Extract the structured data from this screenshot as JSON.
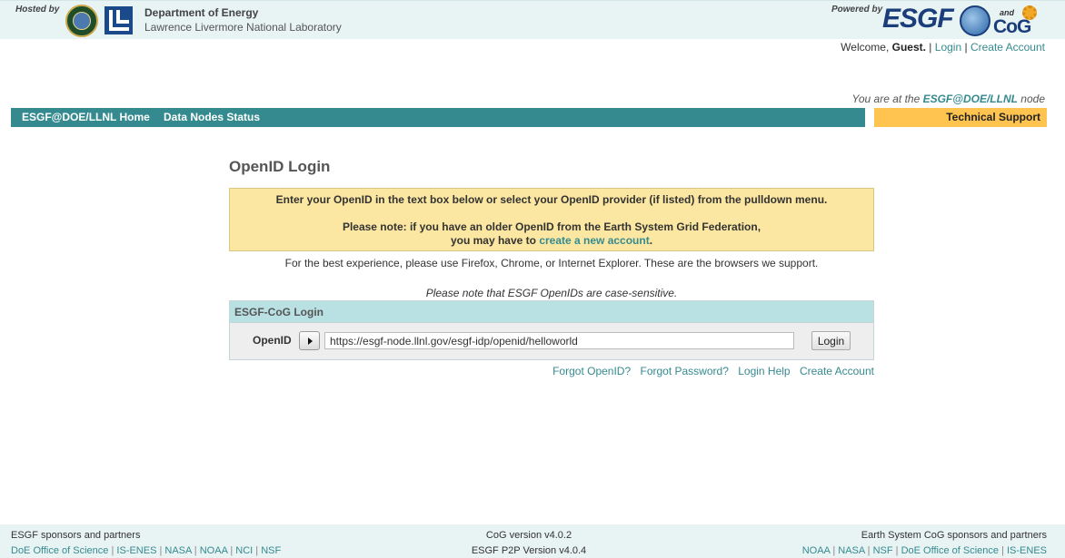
{
  "header": {
    "hosted_by": "Hosted by",
    "org_name": "Department of Energy",
    "org_sub": "Lawrence Livermore National Laboratory",
    "powered_by": "Powered by",
    "esgf_text": "ESGF",
    "and_text": "and",
    "cog_text": "CoG",
    "icons": {
      "doe": "doe-seal-icon",
      "llnl": "llnl-logo-icon",
      "globe": "globe-icon",
      "gear": "gear-icon"
    }
  },
  "welcome": {
    "prefix": "Welcome, ",
    "user": "Guest.",
    "sep1": " | ",
    "login": "Login",
    "sep2": " | ",
    "create_account": "Create Account"
  },
  "location": {
    "prefix": "You are at the ",
    "node": "ESGF@DOE/LLNL",
    "suffix": " node"
  },
  "nav": {
    "home": "ESGF@DOE/LLNL Home",
    "status": "Data Nodes Status",
    "support": "Technical Support"
  },
  "main": {
    "title": "OpenID Login",
    "notice_line1": "Enter your OpenID in the text box below or select your OpenID provider (if listed) from the pulldown menu.",
    "notice_line2": "Please note: if you have an older OpenID from the Earth System Grid Federation,",
    "notice_line3_prefix": "you may have to ",
    "notice_line3_link": "create a new account",
    "notice_line3_suffix": ".",
    "browsers_note": "For the best experience, please use Firefox, Chrome, or Internet Explorer. These are the browsers we support.",
    "case_note": "Please note that ESGF OpenIDs are case-sensitive."
  },
  "login_box": {
    "header": "ESGF-CoG Login",
    "openid_label": "OpenID",
    "openid_value": "https://esgf-node.llnl.gov/esgf-idp/openid/helloworld",
    "login_button": "Login"
  },
  "help_links": {
    "forgot_openid": "Forgot OpenID?",
    "forgot_password": "Forgot Password?",
    "login_help": "Login Help",
    "create_account": "Create Account"
  },
  "footer": {
    "left_title": "ESGF sponsors and partners",
    "left_links": [
      "DoE Office of Science",
      "IS-ENES",
      "NASA",
      "NOAA",
      "NCI",
      "NSF"
    ],
    "cog_version": "CoG version v4.0.2",
    "p2p_version": "ESGF P2P Version v4.0.4",
    "right_title": "Earth System CoG sponsors and partners",
    "right_links": [
      "NOAA",
      "NASA",
      "NSF",
      "DoE Office of Science",
      "IS-ENES"
    ]
  },
  "colors": {
    "accent_teal": "#358a8f",
    "support_orange": "#ffc450",
    "notice_yellow": "#fbe7a1",
    "header_bg": "#e8f3f4"
  }
}
